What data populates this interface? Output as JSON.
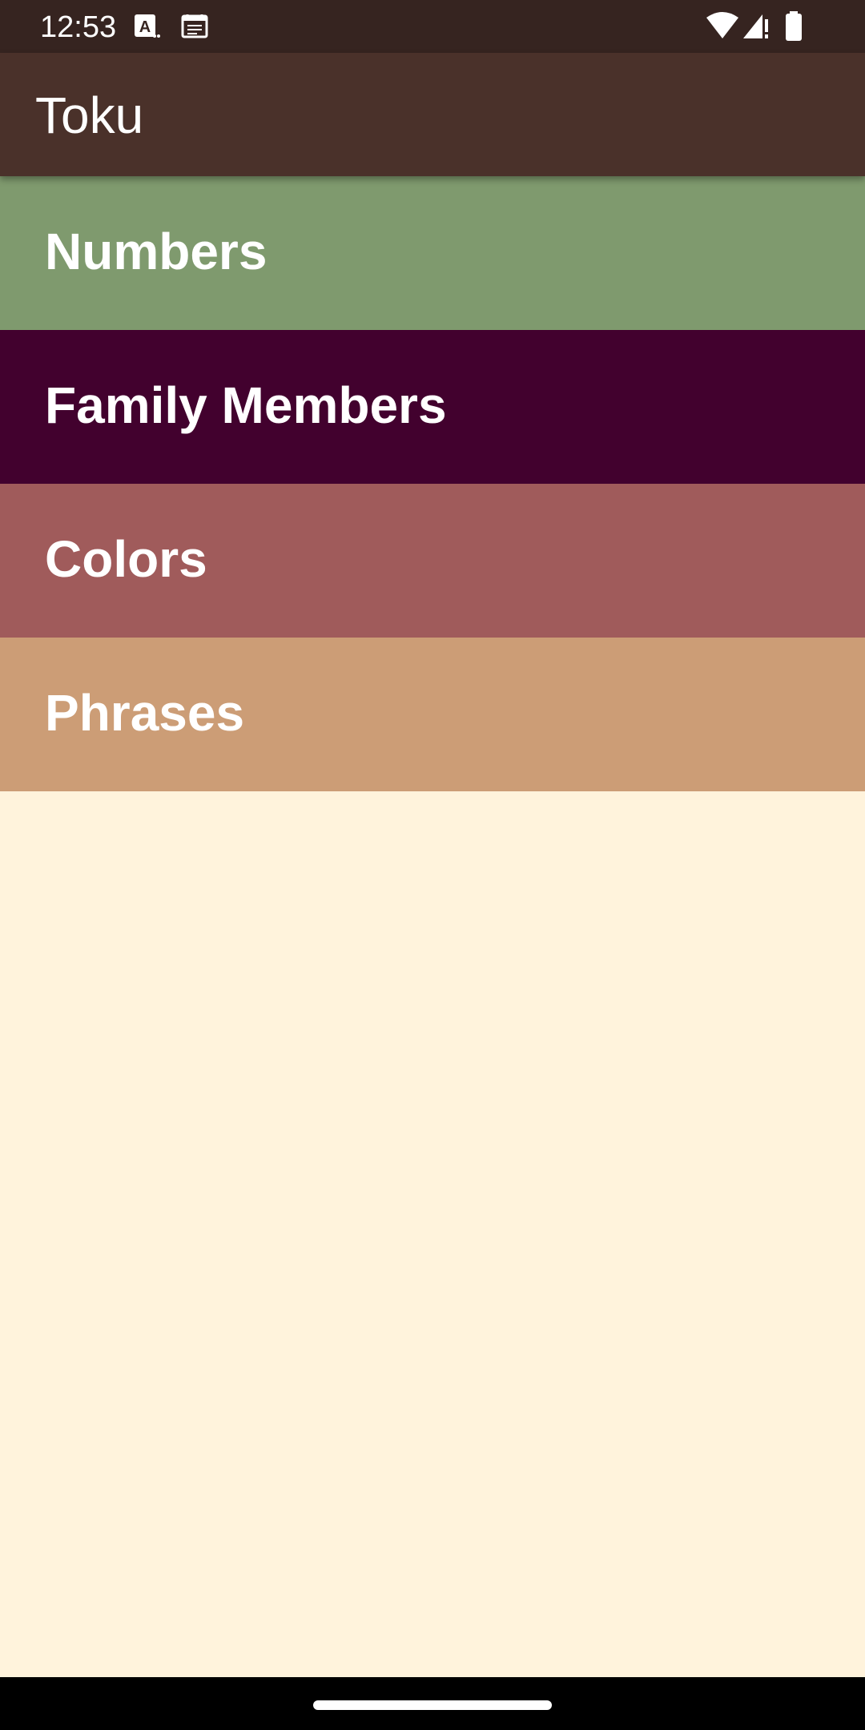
{
  "status_bar": {
    "time": "12:53",
    "left_icons": [
      "text-a-icon",
      "calendar-news-icon"
    ],
    "right_icons": [
      "wifi-icon",
      "cellular-alert-icon",
      "battery-icon"
    ]
  },
  "app_bar": {
    "title": "Toku"
  },
  "categories": [
    {
      "label": "Numbers",
      "color": "#7F9A6E"
    },
    {
      "label": "Family Members",
      "color": "#42012E"
    },
    {
      "label": "Colors",
      "color": "#A05B5B"
    },
    {
      "label": "Phrases",
      "color": "#CC9D76"
    }
  ],
  "colors": {
    "status_bar": "#362420",
    "app_bar": "#4A312A",
    "background": "#FFF3DC",
    "nav_bar": "#000000"
  }
}
